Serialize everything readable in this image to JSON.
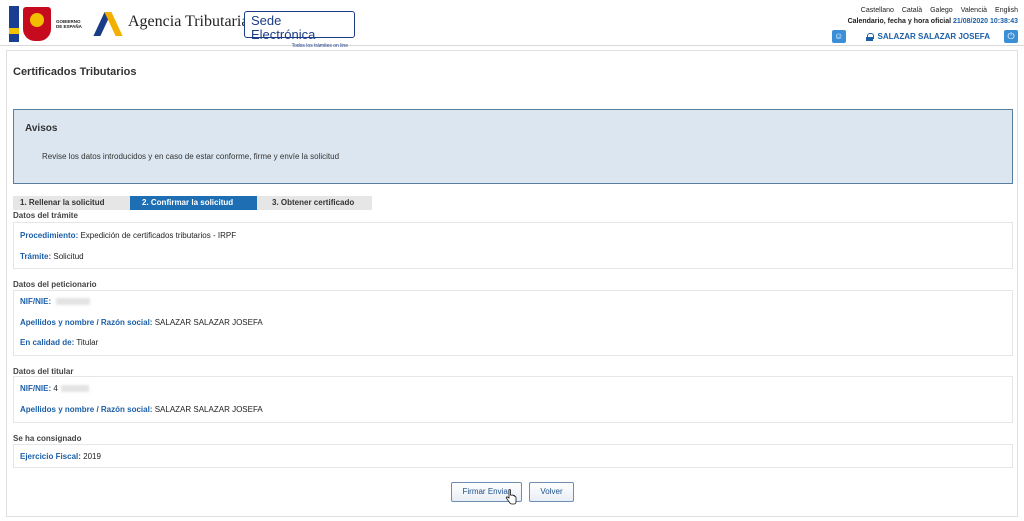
{
  "header": {
    "gov_text": "GOBIERNO DE ESPAÑA",
    "agency_name": "Agencia Tributaria",
    "sede_title": "Sede Electrónica",
    "sede_subtitle": "Todos los trámites on line",
    "languages": [
      "Castellano",
      "Català",
      "Galego",
      "Valencià",
      "English"
    ],
    "calendar_label": "Calendario, fecha y hora oficial",
    "calendar_datetime": "21/08/2020 10:38:43",
    "user_name": "SALAZAR SALAZAR JOSEFA",
    "colors": {
      "brand_blue": "#1b3c87",
      "link_blue": "#1b5fa8",
      "step_active": "#1e6eb4"
    }
  },
  "page": {
    "title": "Certificados Tributarios",
    "avisos": {
      "title": "Avisos",
      "text": "Revise los datos introducidos y en caso de estar conforme, firme y envíe la solicitud"
    },
    "steps": [
      "1. Rellenar la solicitud",
      "2. Confirmar la solicitud",
      "3. Obtener certificado"
    ],
    "active_step": 2
  },
  "tramite": {
    "label": "Datos del trámite",
    "procedimiento_key": "Procedimiento:",
    "procedimiento_val": "Expedición de certificados tributarios - IRPF",
    "tramite_key": "Trámite:",
    "tramite_val": "Solicitud"
  },
  "peticionario": {
    "label": "Datos del peticionario",
    "nif_key": "NIF/NIE:",
    "nombre_key": "Apellidos y nombre / Razón social:",
    "nombre_val": "SALAZAR SALAZAR JOSEFA",
    "calidad_key": "En calidad de:",
    "calidad_val": "Titular"
  },
  "titular": {
    "label": "Datos del titular",
    "nif_key": "NIF/NIE:",
    "nif_prefix": "4",
    "nombre_key": "Apellidos y nombre / Razón social:",
    "nombre_val": "SALAZAR SALAZAR JOSEFA"
  },
  "consignado": {
    "label": "Se ha consignado",
    "ejercicio_key": "Ejercicio Fiscal:",
    "ejercicio_val": "2019"
  },
  "actions": {
    "firmar": "Firmar Enviar",
    "volver": "Volver"
  }
}
